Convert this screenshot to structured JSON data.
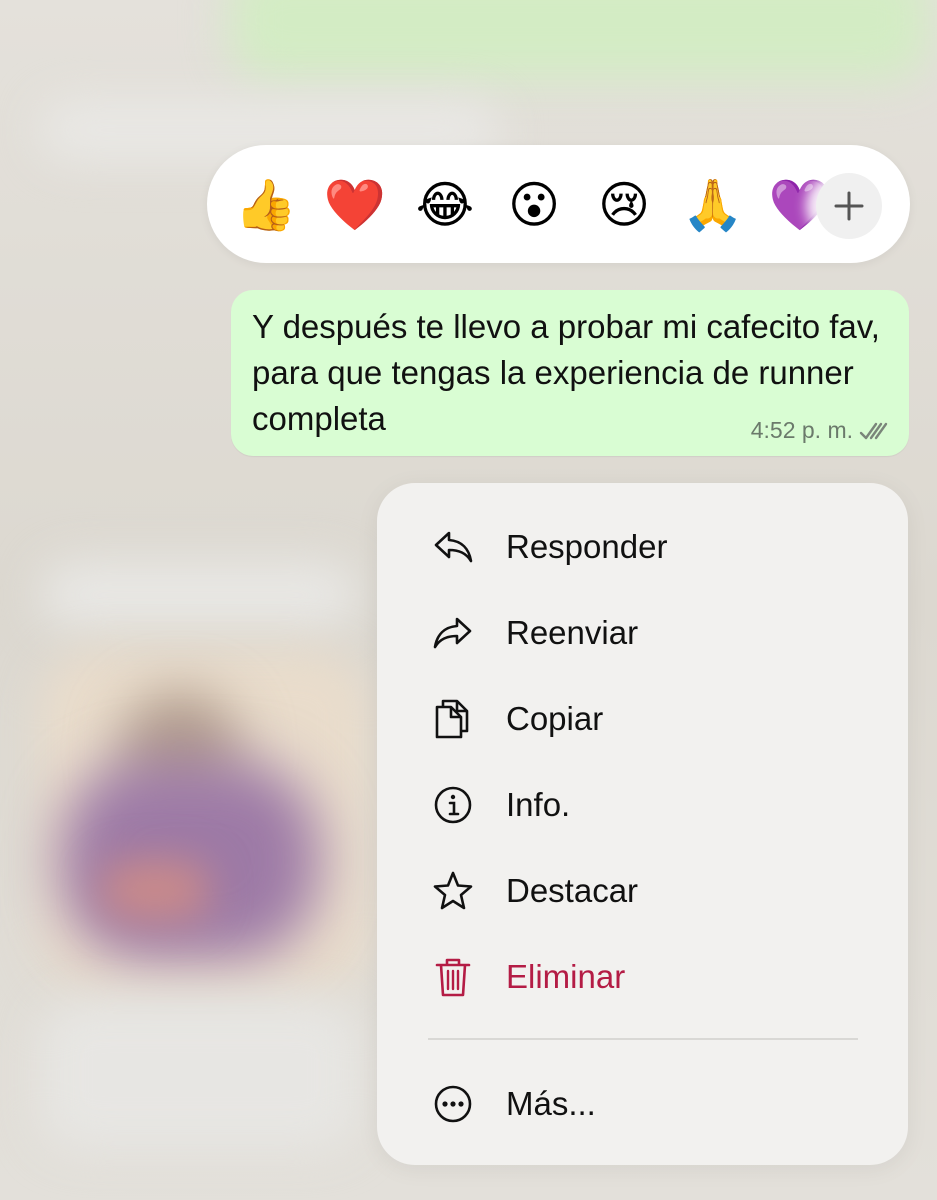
{
  "reactions": {
    "emojis": [
      {
        "glyph": "👍",
        "name": "thumbs-up"
      },
      {
        "glyph": "❤️",
        "name": "red-heart"
      },
      {
        "glyph": "😂",
        "name": "tears-of-joy"
      },
      {
        "glyph": "😮",
        "name": "surprised-face"
      },
      {
        "glyph": "😢",
        "name": "crying-face"
      },
      {
        "glyph": "🙏",
        "name": "folded-hands"
      },
      {
        "glyph": "💜",
        "name": "purple-heart"
      }
    ],
    "more_icon": "plus-icon"
  },
  "message": {
    "text": "Y después te llevo a probar mi cafecito fav, para que tengas la experiencia de runner completa",
    "time": "4:52 p. m.",
    "status_icon": "double-check-icon",
    "bubble_color": "#d9fdd3"
  },
  "menu": {
    "items": [
      {
        "label": "Responder",
        "icon": "reply-icon"
      },
      {
        "label": "Reenviar",
        "icon": "forward-icon"
      },
      {
        "label": "Copiar",
        "icon": "copy-icon"
      },
      {
        "label": "Info.",
        "icon": "info-icon"
      },
      {
        "label": "Destacar",
        "icon": "star-icon"
      },
      {
        "label": "Eliminar",
        "icon": "trash-icon",
        "color": "#b41c45"
      },
      {
        "label": "Más...",
        "icon": "more-icon"
      }
    ]
  }
}
